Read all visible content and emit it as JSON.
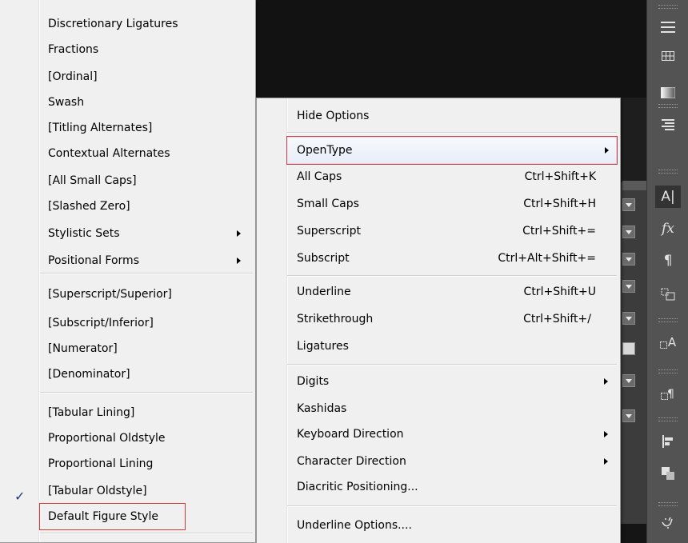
{
  "left_menu": {
    "groups": [
      [
        {
          "label": "Discretionary Ligatures"
        },
        {
          "label": "Fractions"
        },
        {
          "label": "[Ordinal]"
        },
        {
          "label": "Swash"
        },
        {
          "label": "[Titling Alternates]"
        },
        {
          "label": "Contextual Alternates"
        },
        {
          "label": "[All Small Caps]"
        },
        {
          "label": "[Slashed Zero]"
        },
        {
          "label": "Stylistic Sets",
          "submenu": true
        },
        {
          "label": "Positional Forms",
          "submenu": true
        }
      ],
      [
        {
          "label": "[Superscript/Superior]"
        },
        {
          "label": "[Subscript/Inferior]"
        },
        {
          "label": "[Numerator]"
        },
        {
          "label": "[Denominator]"
        }
      ],
      [
        {
          "label": "[Tabular Lining]"
        },
        {
          "label": "Proportional Oldstyle"
        },
        {
          "label": "Proportional Lining"
        },
        {
          "label": "[Tabular Oldstyle]"
        },
        {
          "label": "Default Figure Style",
          "checked": true
        }
      ]
    ]
  },
  "right_menu": {
    "items": {
      "hide_options": {
        "label": "Hide Options"
      },
      "opentype": {
        "label": "OpenType"
      },
      "all_caps": {
        "label": "All Caps",
        "shortcut": "Ctrl+Shift+K"
      },
      "small_caps": {
        "label": "Small Caps",
        "shortcut": "Ctrl+Shift+H"
      },
      "superscript": {
        "label": "Superscript",
        "shortcut": "Ctrl+Shift+="
      },
      "subscript": {
        "label": "Subscript",
        "shortcut": "Ctrl+Alt+Shift+="
      },
      "underline": {
        "label": "Underline",
        "shortcut": "Ctrl+Shift+U"
      },
      "strikethrough": {
        "label": "Strikethrough",
        "shortcut": "Ctrl+Shift+/"
      },
      "ligatures": {
        "label": "Ligatures"
      },
      "digits": {
        "label": "Digits"
      },
      "kashidas": {
        "label": "Kashidas"
      },
      "keyboard_direction": {
        "label": "Keyboard Direction"
      },
      "character_direction": {
        "label": "Character Direction"
      },
      "diacritic_positioning": {
        "label": "Diacritic Positioning..."
      },
      "underline_options": {
        "label": "Underline Options...."
      }
    }
  },
  "toolbar": {
    "icons": [
      "menu-icon",
      "table-icon",
      "gradient-icon",
      "paragraph-align-icon",
      "character-icon",
      "fx-icon",
      "pilcrow-icon",
      "text-wrap-icon",
      "glyph-icon",
      "paragraph-style-icon",
      "align-icon",
      "pathfinder-icon",
      "arabic-script-icon"
    ],
    "labels": {
      "character": "A|",
      "fx": "fx",
      "pilcrow": "¶",
      "glyph_a": "A"
    }
  },
  "colors": {
    "highlight_border": "#d33a3a",
    "menu_bg": "#f0f0f0",
    "check": "#1f3a7a",
    "toolbar_bg": "#535353"
  }
}
